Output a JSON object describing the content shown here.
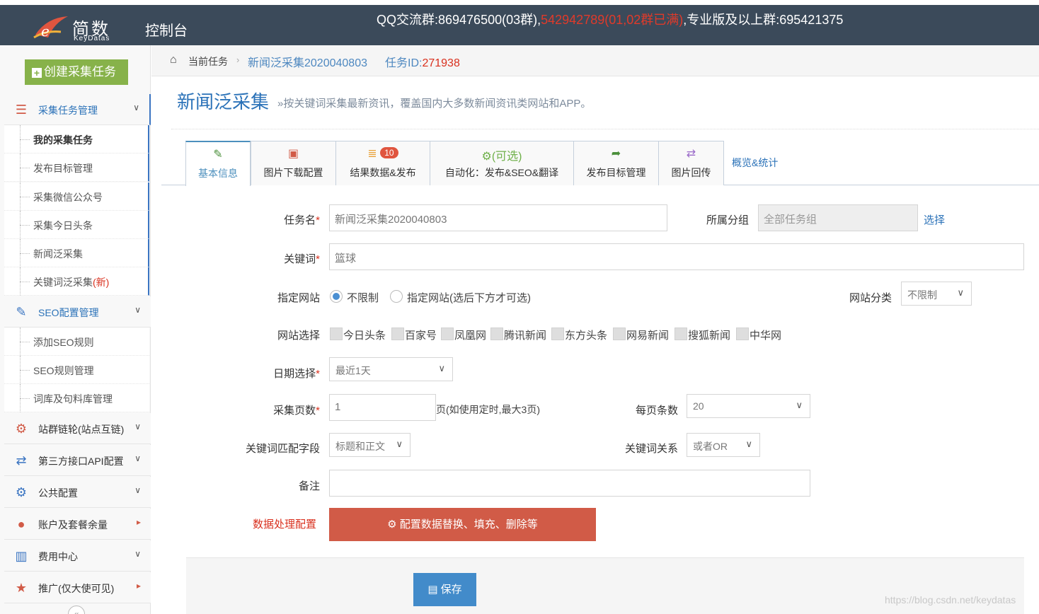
{
  "header": {
    "logo_cn": "简数",
    "logo_en": "KeyDatas",
    "console": "控制台",
    "notice_prefix": "QQ交流群:869476500(03群),",
    "notice_red": "542942789(01,02群已满)",
    "notice_suffix": ",专业版及以上群:695421375"
  },
  "sidebar": {
    "create_button": "创建采集任务",
    "groups": [
      {
        "label": "采集任务管理",
        "icon": "list-icon"
      },
      {
        "label": "SEO配置管理",
        "icon": "edit-icon"
      },
      {
        "label": "站群链轮(站点互链)",
        "icon": "gears-icon"
      },
      {
        "label": "第三方接口API配置",
        "icon": "exchange-icon"
      },
      {
        "label": "公共配置",
        "icon": "gear-icon"
      },
      {
        "label": "账户及套餐余量",
        "icon": "user-icon"
      },
      {
        "label": "费用中心",
        "icon": "bar-chart-icon"
      },
      {
        "label": "推广(仅大使可见)",
        "icon": "star-icon"
      }
    ],
    "task_items": [
      "我的采集任务",
      "发布目标管理",
      "采集微信公众号",
      "采集今日头条",
      "新闻泛采集",
      "关键词泛采集"
    ],
    "task_item_new_tag": "(新)",
    "seo_items": [
      "添加SEO规则",
      "SEO规则管理",
      "词库及句料库管理"
    ]
  },
  "breadcrumb": {
    "current": "当前任务",
    "task_name": "新闻泛采集2020040803",
    "task_id_label": "任务ID:",
    "task_id": "271938"
  },
  "page": {
    "title": "新闻泛采集",
    "description": "»按关键词采集最新资讯，覆盖国内大多数新闻资讯类网站和APP。"
  },
  "tabs": [
    {
      "label": "基本信息",
      "icon": "edit-icon"
    },
    {
      "label": "图片下载配置",
      "icon": "image-icon"
    },
    {
      "label": "结果数据&发布",
      "icon": "database-icon",
      "badge": "10"
    },
    {
      "label": "自动化：发布&SEO&翻译",
      "icon": "gears-icon",
      "top": "(可选)"
    },
    {
      "label": "发布目标管理",
      "icon": "share-icon"
    },
    {
      "label": "图片回传",
      "icon": "exchange-icon"
    },
    {
      "label": "概览&统计"
    }
  ],
  "form": {
    "task_name_label": "任务名",
    "task_name_value": "新闻泛采集2020040803",
    "group_label": "所属分组",
    "group_value": "全部任务组",
    "group_select": "选择",
    "keyword_label": "关键词",
    "keyword_value": "篮球",
    "site_label": "指定网站",
    "site_opt_unlimited": "不限制",
    "site_opt_specified": "指定网站(选后下方才可选)",
    "site_category_label": "网站分类",
    "site_category_value": "不限制",
    "site_select_label": "网站选择",
    "sites": [
      "今日头条",
      "百家号",
      "凤凰网",
      "腾讯新闻",
      "东方头条",
      "网易新闻",
      "搜狐新闻",
      "中华网"
    ],
    "date_label": "日期选择",
    "date_value": "最近1天",
    "pages_label": "采集页数",
    "pages_value": "1",
    "pages_hint": "页(如使用定时,最大3页)",
    "per_page_label": "每页条数",
    "per_page_value": "20",
    "match_field_label": "关键词匹配字段",
    "match_field_value": "标题和正文",
    "relation_label": "关键词关系",
    "relation_value": "或者OR",
    "note_label": "备注",
    "note_value": "",
    "data_proc_label": "数据处理配置",
    "data_proc_button": "配置数据替换、填充、删除等",
    "save_button": "保存",
    "required_mark": "*"
  },
  "watermark": "https://blog.csdn.net/keydatas"
}
